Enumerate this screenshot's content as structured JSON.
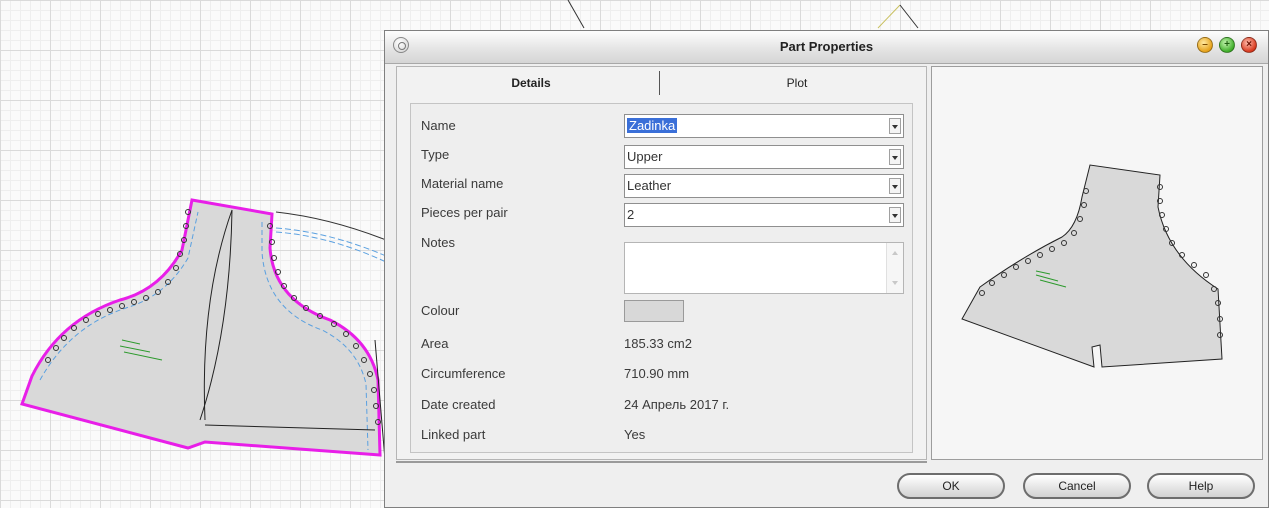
{
  "dialog": {
    "title": "Part Properties",
    "tabs": [
      {
        "label": "Details",
        "active": true
      },
      {
        "label": "Plot",
        "active": false
      }
    ],
    "fields": {
      "name": {
        "label": "Name",
        "value": "Zadinka",
        "selected": true
      },
      "type": {
        "label": "Type",
        "value": "Upper"
      },
      "material": {
        "label": "Material name",
        "value": "Leather"
      },
      "pieces": {
        "label": "Pieces per pair",
        "value": "2"
      },
      "notes": {
        "label": "Notes",
        "value": ""
      },
      "colour": {
        "label": "Colour",
        "swatch": "#d8d8d8"
      },
      "area": {
        "label": "Area",
        "value": "185.33 cm2"
      },
      "circumference": {
        "label": "Circumference",
        "value": "710.90 mm"
      },
      "date_created": {
        "label": "Date created",
        "value": "24 Апрель 2017 г."
      },
      "linked_part": {
        "label": "Linked part",
        "value": "Yes"
      }
    },
    "buttons": {
      "ok": "OK",
      "cancel": "Cancel",
      "help": "Help"
    }
  },
  "colors": {
    "part_outline_highlight": "#e81ee8",
    "part_fill": "#d9d9d9",
    "seam_line": "#5aa0e0",
    "selection": "#3a6fd8"
  }
}
